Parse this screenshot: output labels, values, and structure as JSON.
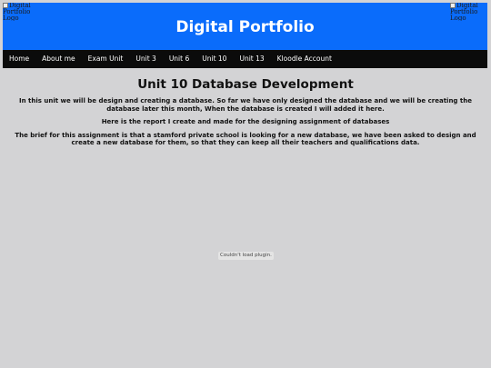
{
  "header": {
    "title": "Digital Portfolio",
    "logo_left_alt": "Digital Portfolio Logo",
    "logo_right_alt": "Digital Portfolio Logo"
  },
  "nav": {
    "items": [
      {
        "label": "Home"
      },
      {
        "label": "About me"
      },
      {
        "label": "Exam Unit"
      },
      {
        "label": "Unit 3"
      },
      {
        "label": "Unit 6"
      },
      {
        "label": "Unit 10"
      },
      {
        "label": "Unit 13"
      },
      {
        "label": "Kloodle Account"
      }
    ]
  },
  "main": {
    "title": "Unit 10 Database Development",
    "paragraphs": [
      "In this unit we will be design and creating a database. So far we have only designed the database and we will be creating the database later this month, When the database is created I will added it here.",
      "Here is the report I create and made for the designing assignment of databases",
      "The brief for this assignment is that a stamford private school is looking for a new database, we have been asked to design and create a new database for them, so that they can keep all their teachers and qualifications data."
    ],
    "plugin_message": "Couldn't load plugin."
  },
  "colors": {
    "header_bg": "#0a6cfb",
    "nav_bg": "#0b0b0b",
    "page_bg": "#d3d3d5"
  }
}
